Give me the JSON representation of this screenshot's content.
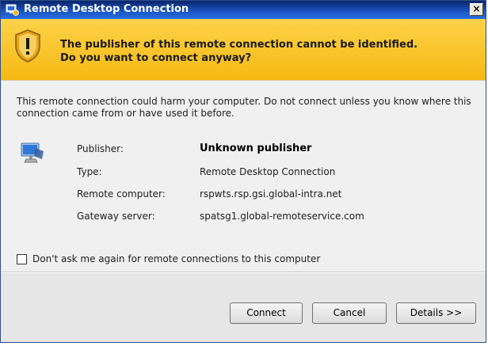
{
  "window": {
    "title": "Remote Desktop Connection",
    "close_glyph": "×"
  },
  "icons": {
    "title": "remote-desktop-icon",
    "banner": "shield-warning-icon",
    "content": "remote-computer-icon"
  },
  "banner": {
    "line1": "The publisher of this remote connection cannot be identified.",
    "line2": "Do you want to connect anyway?"
  },
  "warning": "This remote connection could harm your computer. Do not connect unless you know where this connection came from or have used it before.",
  "details": [
    {
      "label": "Publisher:",
      "value": "Unknown publisher"
    },
    {
      "label": "Type:",
      "value": "Remote Desktop Connection"
    },
    {
      "label": "Remote computer:",
      "value": "rspwts.rsp.gsi.global-intra.net"
    },
    {
      "label": "Gateway server:",
      "value": "spatsg1.global-remoteservice.com"
    }
  ],
  "checkbox": {
    "label": "Don't ask me again for remote connections to this computer",
    "checked": false
  },
  "buttons": {
    "connect": "Connect",
    "cancel": "Cancel",
    "details": "Details >>"
  },
  "colors": {
    "banner_top": "#fcd24a",
    "banner_bottom": "#f6b913",
    "titlebar": "#1b56c6"
  }
}
